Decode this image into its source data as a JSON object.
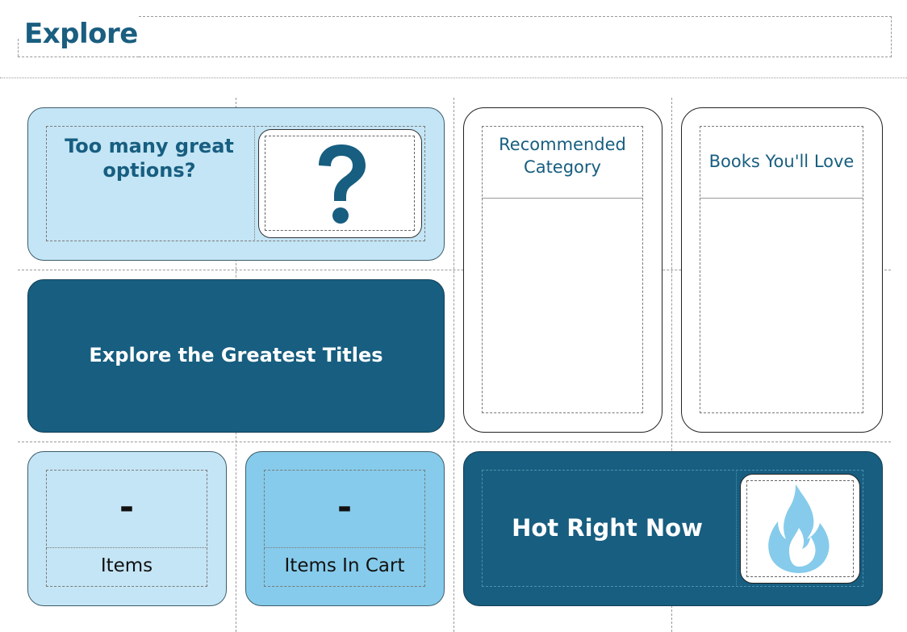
{
  "header": {
    "title": "Explore"
  },
  "promo": {
    "title": "Too many great options?",
    "icon": "question-mark-icon"
  },
  "recommended": {
    "label": "Recommended Category"
  },
  "books": {
    "label": "Books You'll Love"
  },
  "explore_button": {
    "label": "Explore the Greatest Titles"
  },
  "stats": [
    {
      "value": "-",
      "label": "Items"
    },
    {
      "value": "-",
      "label": "Items In Cart"
    }
  ],
  "hot": {
    "label": "Hot Right Now",
    "icon": "flame-icon"
  },
  "colors": {
    "dark_blue": "#175e80",
    "light_blue": "#c4e5f5",
    "mid_blue": "#86cbeb",
    "flame": "#86cbeb"
  }
}
